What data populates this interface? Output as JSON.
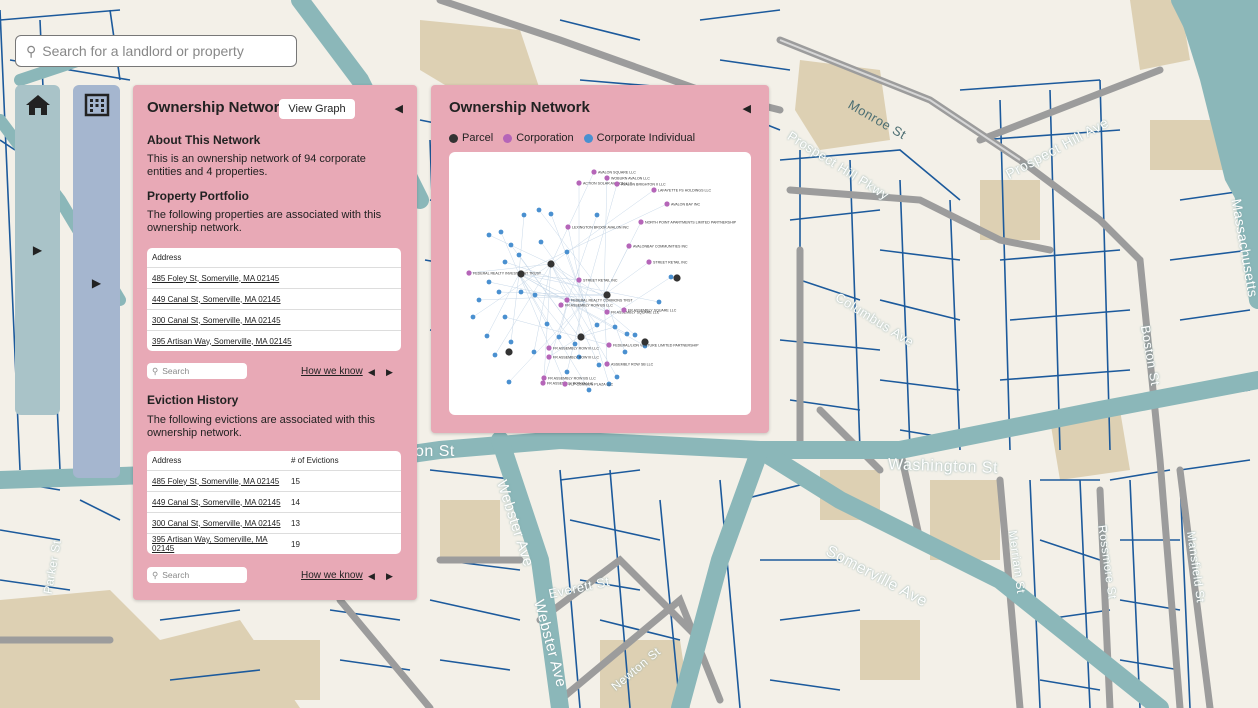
{
  "search": {
    "placeholder": "Search for a landlord or property"
  },
  "map": {
    "labels": {
      "washington": "Washington St",
      "webster1": "Webster Ave",
      "webster2": "Webster Ave",
      "somerville": "Somerville Ave",
      "boston": "Boston St",
      "columbus": "Columbus Ave",
      "prospect_hill_ave": "Prospect Hill Ave",
      "prospect_hill_pkwy": "Prospect Hill Pkwy",
      "everett": "Everett St",
      "newton": "Newton St",
      "merriam": "Merriam St",
      "rossmore": "Rossmore St",
      "mansfield": "Mansfield St",
      "massachusetts": "Massachusetts",
      "parker": "Parker St",
      "monroe": "Monroe St",
      "on_st": "on St"
    }
  },
  "ownership_panel": {
    "title": "Ownership Network",
    "view_graph_label": "View Graph",
    "about_title": "About This Network",
    "about_text": "This is an ownership network of 94 corporate entities and 4 properties.",
    "portfolio_title": "Property Portfolio",
    "portfolio_text": "The following properties are associated with this ownership network.",
    "portfolio_table": {
      "header": "Address",
      "rows": [
        "485 Foley St, Somerville, MA 02145",
        "449 Canal St, Somerville, MA 02145",
        "300 Canal St, Somerville, MA 02145",
        "395 Artisan Way, Somerville, MA 02145"
      ]
    },
    "search_placeholder": "Search",
    "how_we_know": "How we know",
    "eviction_title": "Eviction History",
    "eviction_text": "The following evictions are associated with this ownership network.",
    "eviction_table": {
      "header_address": "Address",
      "header_count": "# of Evictions",
      "rows": [
        {
          "address": "485 Foley St, Somerville, MA 02145",
          "count": "15"
        },
        {
          "address": "449 Canal St, Somerville, MA 02145",
          "count": "14"
        },
        {
          "address": "300 Canal St, Somerville, MA 02145",
          "count": "13"
        },
        {
          "address": "395 Artisan Way, Somerville, MA 02145",
          "count": "19"
        }
      ]
    }
  },
  "graph_panel": {
    "title": "Ownership Network",
    "legend": [
      {
        "label": "Parcel",
        "color": "#333333"
      },
      {
        "label": "Corporation",
        "color": "#b565b8"
      },
      {
        "label": "Corporate Individual",
        "color": "#4a90d0"
      }
    ],
    "node_labels": [
      "AVALON SQUARE LLC",
      "WOBURN AVALON LLC",
      "ACTION SOLAR AVALON LLC",
      "AVALON BRIGHTON II LLC",
      "LAFAYETTE FS HOLDINGS LLC",
      "AVALON BAY INC",
      "NORTH POINT APARTMENTS LIMITED PARTNERSHIP",
      "LEXINGTON BROOK AVALON INC",
      "AVALONBAY COMMUNITIES INC",
      "STREET RETAIL INC",
      "FEDERAL REALTY INVESTMENT TRUST",
      "STREET RETAIL INC",
      "FR ASSEMBLY SQUARE LLC",
      "FR ASSEMBLY ROW III LLC",
      "FEDERAL REALTY COMMONS TRST",
      "FR ASSEMBLY ROW BS LLC",
      "FR ASSEMBLY SQUARE LLC",
      "FEDERAL/LION VENTURE LIMITED PARTNERSHIP",
      "FR ASSEMBLY ROW III LLC",
      "FR ASSEMBLY ROW BS LLC",
      "ASSEMBLY ROW SB LLC",
      "FR ASSEMBLY ROW III LLC",
      "FLP COMMON PLAZA LLC"
    ]
  }
}
